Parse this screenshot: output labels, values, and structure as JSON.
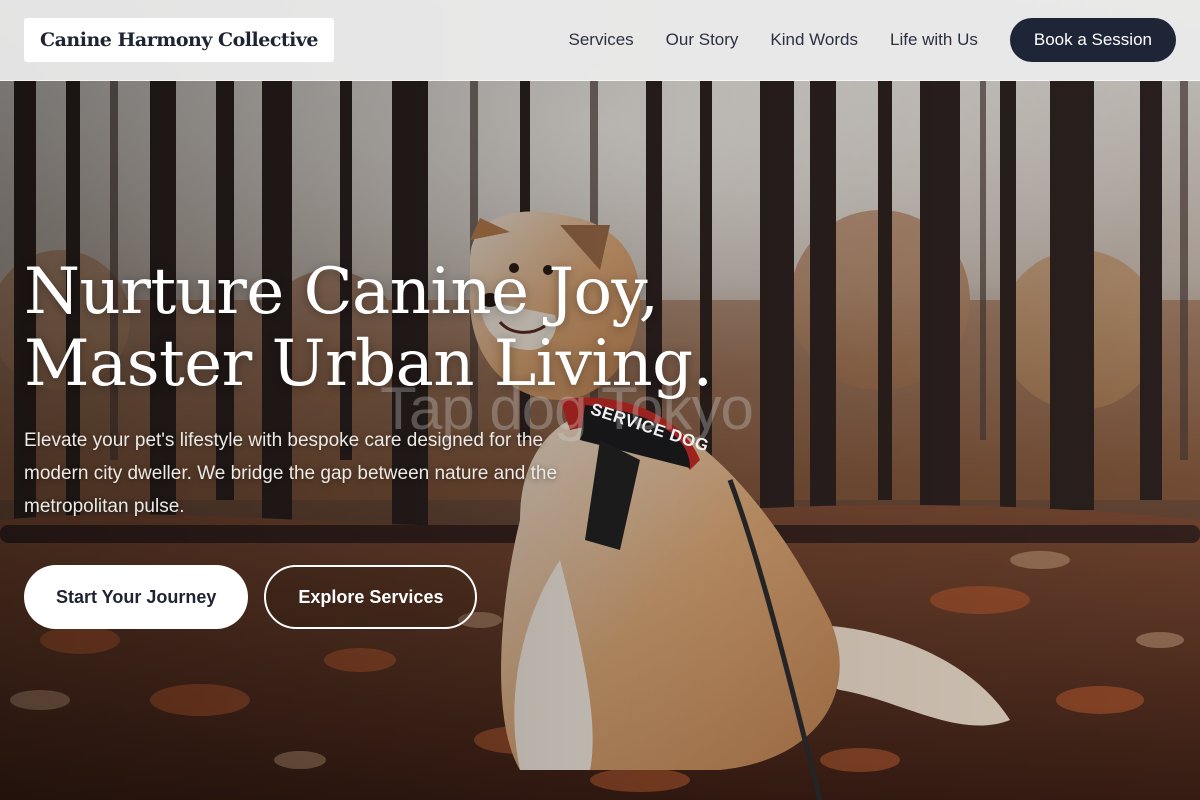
{
  "header": {
    "brand": "Canine Harmony Collective",
    "nav": [
      "Services",
      "Our Story",
      "Kind Words",
      "Life with Us"
    ],
    "cta": "Book a Session"
  },
  "hero": {
    "headline_line1": "Nurture Canine Joy,",
    "headline_line2": "Master Urban Living.",
    "subcopy": "Elevate your pet's lifestyle with bespoke care designed for the modern city dweller. We bridge the gap between nature and the metropolitan pulse.",
    "primary_button": "Start Your Journey",
    "secondary_button": "Explore Services",
    "vest_text": "SERVICE DOG",
    "watermark": "Tap dog Tokyo"
  },
  "colors": {
    "header_bg": "#ececec",
    "nav_text": "#2c3140",
    "cta_bg": "#1e2537",
    "hero_text": "#ffffff",
    "vest_red": "#c32a25"
  }
}
